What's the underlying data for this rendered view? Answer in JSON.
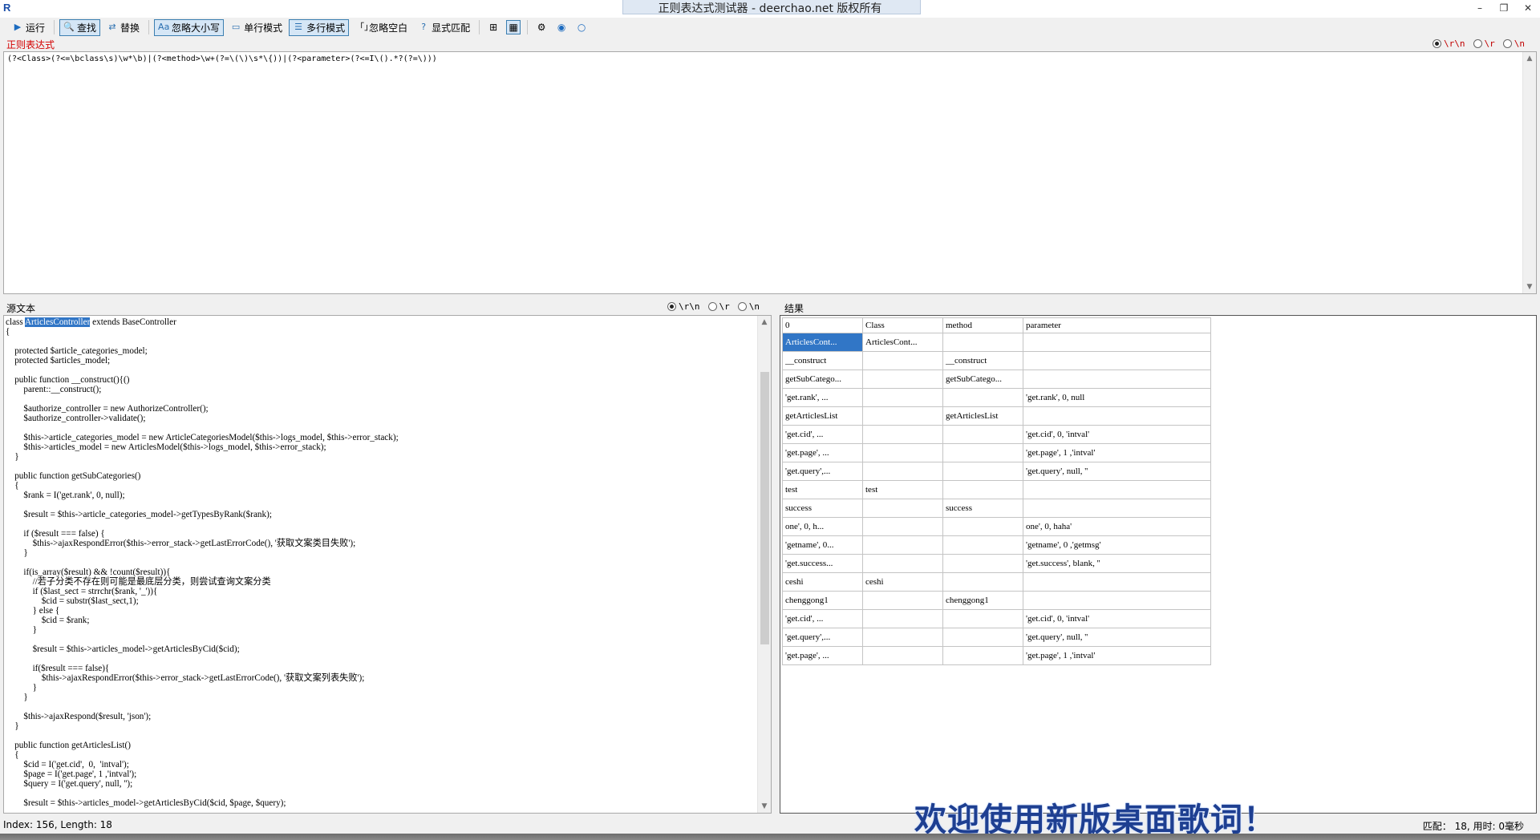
{
  "window": {
    "title": "正则表达式测试器 - deerchao.net 版权所有",
    "minimize": "–",
    "restore": "❐",
    "close": "✕"
  },
  "toolbar": {
    "run": "运行",
    "find": "查找",
    "replace": "替换",
    "ignore_case": "忽略大小写",
    "single_line": "单行模式",
    "multi_line": "多行模式",
    "ignore_whitespace": "忽略空白",
    "explicit_capture": "显式匹配"
  },
  "regex": {
    "label": "正则表达式",
    "pattern": "(?<Class>(?<=\\bclass\\s)\\w*\\b)|(?<method>\\w+(?=\\(\\)\\s*\\{))|(?<parameter>(?<=I\\().*?(?=\\)))",
    "newline_options": [
      "\\r\\n",
      "\\r",
      "\\n"
    ]
  },
  "source": {
    "label": "源文本",
    "newline_options": [
      "\\r\\n",
      "\\r",
      "\\n"
    ],
    "lines": [
      "class ",
      "{",
      "",
      "    protected $article_categories_model;",
      "    protected $articles_model;",
      "",
      "    public function __construct(){()",
      "        parent::__construct();",
      "",
      "        $authorize_controller = new AuthorizeController();",
      "        $authorize_controller->validate();",
      "",
      "        $this->article_categories_model = new ArticleCategoriesModel($this->logs_model, $this->error_stack);",
      "        $this->articles_model = new ArticlesModel($this->logs_model, $this->error_stack);",
      "    }",
      "",
      "    public function getSubCategories()",
      "    {",
      "        $rank = I('get.rank', 0, null);",
      "",
      "        $result = $this->article_categories_model->getTypesByRank($rank);",
      "",
      "        if ($result === false) {",
      "            $this->ajaxRespondError($this->error_stack->getLastErrorCode(), '获取文案类目失败');",
      "        }",
      "",
      "        if(is_array($result) && !count($result)){",
      "            //若子分类不存在则可能是最底层分类，则尝试查询文案分类",
      "            if ($last_sect = strrchr($rank, '_')){",
      "                $cid = substr($last_sect,1);",
      "            } else {",
      "                $cid = $rank;",
      "            }",
      "",
      "            $result = $this->articles_model->getArticlesByCid($cid);",
      "",
      "            if($result === false){",
      "                $this->ajaxRespondError($this->error_stack->getLastErrorCode(), '获取文案列表失败');",
      "            }",
      "        }",
      "",
      "        $this->ajaxRespond($result, 'json');",
      "    }",
      "",
      "    public function getArticlesList()",
      "    {",
      "        $cid = I('get.cid',  0,  'intval');",
      "        $page = I('get.page', 1 ,'intval');",
      "        $query = I('get.query', null, '');",
      "",
      "        $result = $this->articles_model->getArticlesByCid($cid, $page, $query);"
    ],
    "first_line_highlight": "ArticlesController",
    "first_line_rest": " extends BaseController"
  },
  "results": {
    "label": "结果",
    "columns": [
      "0",
      "Class",
      "method",
      "parameter"
    ],
    "rows": [
      [
        "ArticlesCont...",
        "ArticlesCont...",
        "",
        ""
      ],
      [
        "__construct",
        "",
        "__construct",
        ""
      ],
      [
        "getSubCatego...",
        "",
        "getSubCatego...",
        ""
      ],
      [
        "'get.rank', ...",
        "",
        "",
        "'get.rank', 0, null"
      ],
      [
        "getArticlesList",
        "",
        "getArticlesList",
        ""
      ],
      [
        "'get.cid',  ...",
        "",
        "",
        "'get.cid',  0,  'intval'"
      ],
      [
        "'get.page', ...",
        "",
        "",
        "'get.page', 1 ,'intval'"
      ],
      [
        "'get.query',...",
        "",
        "",
        "'get.query', null, ''"
      ],
      [
        "test",
        "test",
        "",
        ""
      ],
      [
        "success",
        "",
        "success",
        ""
      ],
      [
        "one',  0,  h...",
        "",
        "",
        "one',  0,  haha'"
      ],
      [
        "'getname', 0...",
        "",
        "",
        "'getname', 0 ,'getmsg'"
      ],
      [
        "'get.success...",
        "",
        "",
        "'get.success', blank, ''"
      ],
      [
        "ceshi",
        "ceshi",
        "",
        ""
      ],
      [
        "chenggong1",
        "",
        "chenggong1",
        ""
      ],
      [
        "'get.cid',  ...",
        "",
        "",
        "'get.cid',  0,  'intval'"
      ],
      [
        "'get.query',...",
        "",
        "",
        "'get.query', null, ''"
      ],
      [
        "'get.page', ...",
        "",
        "",
        "'get.page', 1 ,'intval'"
      ]
    ]
  },
  "status": {
    "index": "Index: 156, Length: 18",
    "summary": "匹配： 18, 用时: 0毫秒"
  },
  "overlay": {
    "lyrics": "欢迎使用新版桌面歌词！"
  }
}
